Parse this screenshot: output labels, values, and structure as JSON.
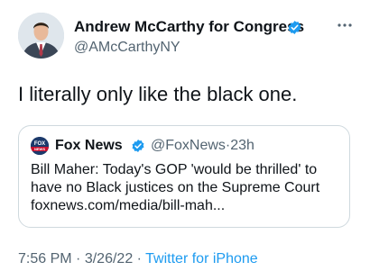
{
  "author": {
    "name": "Andrew McCarthy for Congress",
    "handle": "@AMcCarthyNY",
    "verified": true
  },
  "tweet": {
    "text": "I literally only like the black one."
  },
  "quoted_tweet": {
    "source_name": "Fox News",
    "verified": true,
    "handle": "@FoxNews",
    "separator": "·",
    "age": "23h",
    "avatar_text": "FOX NEWS",
    "text_lines": [
      "Bill Maher: Today's GOP 'would be thrilled' to",
      "have no Black justices on the Supreme Court",
      "foxnews.com/media/bill-mah..."
    ]
  },
  "meta": {
    "time": "7:56 PM",
    "separator": "·",
    "date": "3/26/22",
    "separator2": "·",
    "source": "Twitter for iPhone"
  },
  "icons": {
    "verified": "verified-badge-icon",
    "more": "more-options-icon"
  },
  "colors": {
    "text": "#0f1419",
    "secondary": "#536471",
    "accent": "#1d9bf0",
    "border": "#cfd9de"
  }
}
